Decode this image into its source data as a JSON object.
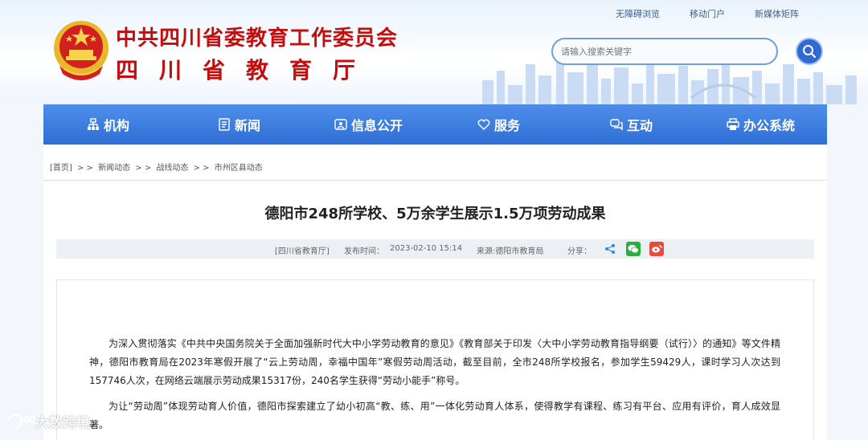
{
  "header": {
    "title_main": "中共四川省委教育工作委员会",
    "title_sub": "四川省教育厅",
    "emblem_icon": "national-emblem-icon",
    "top_links": [
      "无障碍浏览",
      "移动门户",
      "新媒体矩阵"
    ],
    "search": {
      "placeholder": "请输入搜索关键字",
      "icon": "search-icon"
    }
  },
  "nav": {
    "items": [
      {
        "label": "机构",
        "icon": "org-icon"
      },
      {
        "label": "新闻",
        "icon": "news-icon"
      },
      {
        "label": "信息公开",
        "icon": "info-icon"
      },
      {
        "label": "服务",
        "icon": "service-icon"
      },
      {
        "label": "互动",
        "icon": "interaction-icon"
      },
      {
        "label": "办公系统",
        "icon": "office-icon"
      }
    ]
  },
  "breadcrumb": {
    "home": "[首页]",
    "sep": "> >",
    "items": [
      "新闻动态",
      "战线动态",
      "市州区县动态"
    ]
  },
  "article": {
    "title": "德阳市248所学校、5万余学生展示1.5万项劳动成果",
    "meta": {
      "source_tag": "[四川省教育厅]",
      "published_label": "发布时间：",
      "published": "2023-02-10 15:14",
      "source": "来源:德阳市教育局",
      "share_label": "分享："
    },
    "paragraphs": [
      "为深入贯彻落实《中共中央国务院关于全面加强新时代大中小学劳动教育的意见》《教育部关于印发〈大中小学劳动教育指导纲要（试行）〉的通知》等文件精神，德阳市教育局在2023年寒假开展了“云上劳动周，幸福中国年”寒假劳动周活动，截至目前，全市248所学校报名，参加学生59429人，课时学习人次达到157746人次，在网络云端展示劳动成果15317份，240名学生获得“劳动小能手”称号。",
      "为让“劳动周”体现劳动育人价值，德阳市探索建立了幼小初高“教、练、用”一体化劳动育人体系，使得教学有课程、练习有平台、应用有评价，育人成效显著。"
    ]
  },
  "watermark": {
    "text": "大数跨境"
  },
  "colors": {
    "brand_red": "#c40e0e",
    "nav_blue": "#2f6fd6"
  }
}
